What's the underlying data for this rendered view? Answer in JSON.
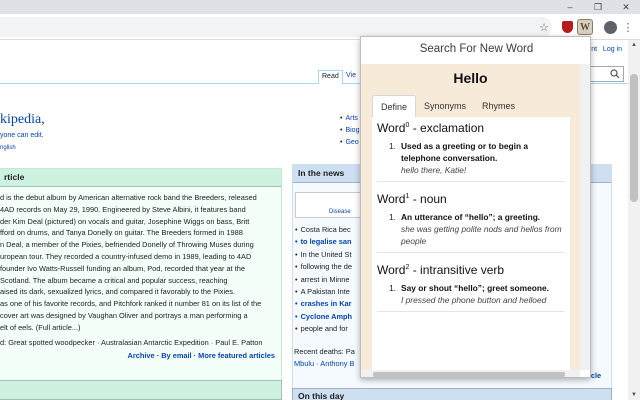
{
  "browser": {
    "win_minimize": "–",
    "win_restore": "❐",
    "win_close": "✕",
    "star_icon": "☆",
    "ext_w_letter": "W",
    "menu_icon": "⋮"
  },
  "wiki": {
    "top_links": [
      "unt",
      "Log in"
    ],
    "tabs": {
      "read": "Read",
      "view": "Vie"
    },
    "welcome_suffix": "kipedia,",
    "anyone": "yone can edit.",
    "english": "nglish",
    "portals": [
      "Arts",
      "Biog",
      "Geo"
    ],
    "tfa_heading": "rticle",
    "tfa_lines": [
      "d is the debut album by American alternative rock band the Breeders, released",
      "4AD records on May 29, 1990. Engineered by Steve Albini, it features band",
      "der Kim Deal (pictured) on vocals and guitar, Josephine Wiggs on bass, Britt",
      "fford on drums, and Tanya Donelly on guitar. The Breeders formed in 1988",
      "n Deal, a member of the Pixies, befriended Donelly of Throwing Muses during",
      "uropean tour. They recorded a country-infused demo in 1989, leading to 4AD",
      "founder Ivo Watts-Russell funding an album, Pod, recorded that year at the",
      "Scotland. The album became a critical and popular success, reaching",
      "aised its dark, sexualized lyrics, and compared it favorably to the Pixies.",
      "as one of his favorite records, and Pitchfork ranked it number 81 on its list of the",
      "cover art was designed by Vaughan Oliver and portrays a man performing a",
      "elt of eels. (Full article...)"
    ],
    "tfa_recent": "d: Great spotted woodpecker · Australasian Antarctic Expedition · Paul E. Patton",
    "tfa_foot": "Archive · By email · More featured articles",
    "itn_heading": "In the news",
    "itn_img_caption": "Disease",
    "itn_items": [
      "Costa Rica bec",
      "to legalise san",
      "In the United St",
      "following the de",
      "arrest in Minne",
      "A Pakistan Inte",
      "crashes in Kar",
      "Cyclone Amph",
      "people and for"
    ],
    "recent_deaths": "Recent deaths: Pa",
    "recent_deaths_2": "Mbulu · Anthony B",
    "other_recent": "Other recent events · Nominate an article",
    "otd_heading": "On this day"
  },
  "popup": {
    "title": "Search For New Word",
    "word": "Hello",
    "tabs": [
      "Define",
      "Synonyms",
      "Rhymes"
    ],
    "entries": [
      {
        "word": "Word",
        "sup": "0",
        "pos": " - exclamation",
        "num": "1.",
        "def": "Used as a greeting or to begin a telephone conversation.",
        "example": "hello there, Katie!"
      },
      {
        "word": "Word",
        "sup": "1",
        "pos": " - noun",
        "num": "1.",
        "def": "An utterance of “hello”; a greeting.",
        "example": "she was getting polite nods and hellos from people"
      },
      {
        "word": "Word",
        "sup": "2",
        "pos": " - intransitive verb",
        "num": "1.",
        "def": "Say or shout “hello”; greet someone.",
        "example": "I pressed the phone button and helloed"
      }
    ]
  }
}
